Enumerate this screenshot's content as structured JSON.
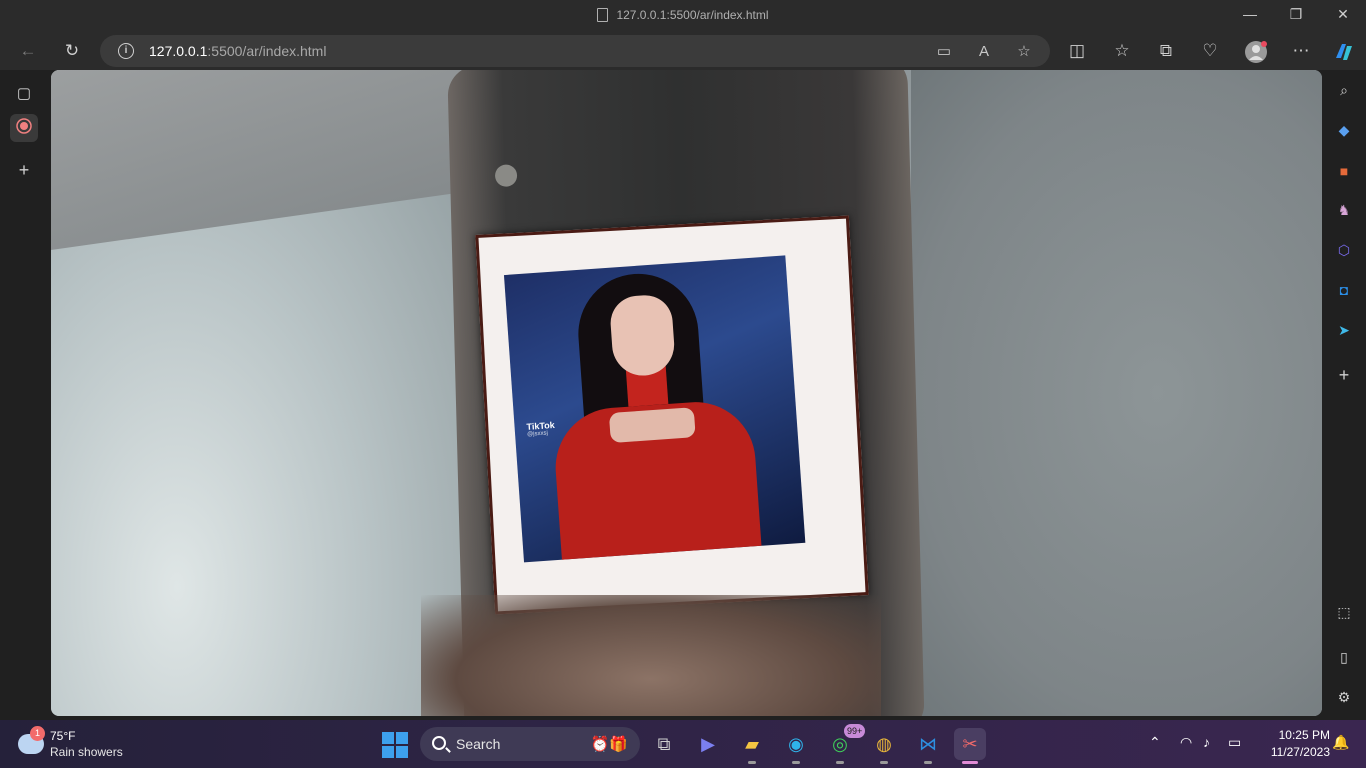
{
  "window": {
    "title": "127.0.0.1:5500/ar/index.html"
  },
  "address_bar": {
    "host": "127.0.0.1",
    "rest": ":5500/ar/index.html"
  },
  "photo": {
    "watermark": "TikTok",
    "handle": "@jsxxsj"
  },
  "taskbar": {
    "weather_badge": "1",
    "temperature": "75°F",
    "condition": "Rain showers",
    "search_label": "Search",
    "whatsapp_badge": "99+",
    "time": "10:25 PM",
    "date": "11/27/2023"
  },
  "colors": {
    "accent": "#3da0ee",
    "frame_border": "#4a1b14",
    "dress": "#b8201b"
  }
}
